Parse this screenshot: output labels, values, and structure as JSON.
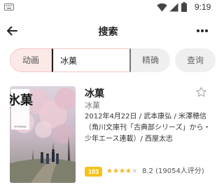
{
  "status_bar": {
    "time": "9:19",
    "icons": [
      "keyboard-icon",
      "wifi-icon",
      "signal-icon",
      "battery-icon"
    ]
  },
  "header": {
    "title": "搜索",
    "back_icon": "back-arrow-icon",
    "more_icon": "more-options-icon"
  },
  "search": {
    "category": "动画",
    "query": "冰菓",
    "exact_label": "精确",
    "submit_label": "查询"
  },
  "colors": {
    "accent_tab_bg": "#fbe9e8",
    "badge": "#f5c21a",
    "star_on": "#f5b21a",
    "star_off": "#d6d6d6"
  },
  "results": [
    {
      "title": "冰菓",
      "subtitle": "冰菓",
      "poster_text": "氷菓",
      "poster_romaji": "HYOUKA",
      "description": "2012年4月22日 / 武本康弘 / 米澤穂信（角川文庫刊「古典部シリーズ」から・少年エース連載）/ 西屋太志",
      "rank": "103",
      "stars_filled": 4,
      "stars_total": 5,
      "score": "8.2",
      "votes": "(19054人评分)",
      "favorite_icon": "star-outline-icon"
    }
  ]
}
